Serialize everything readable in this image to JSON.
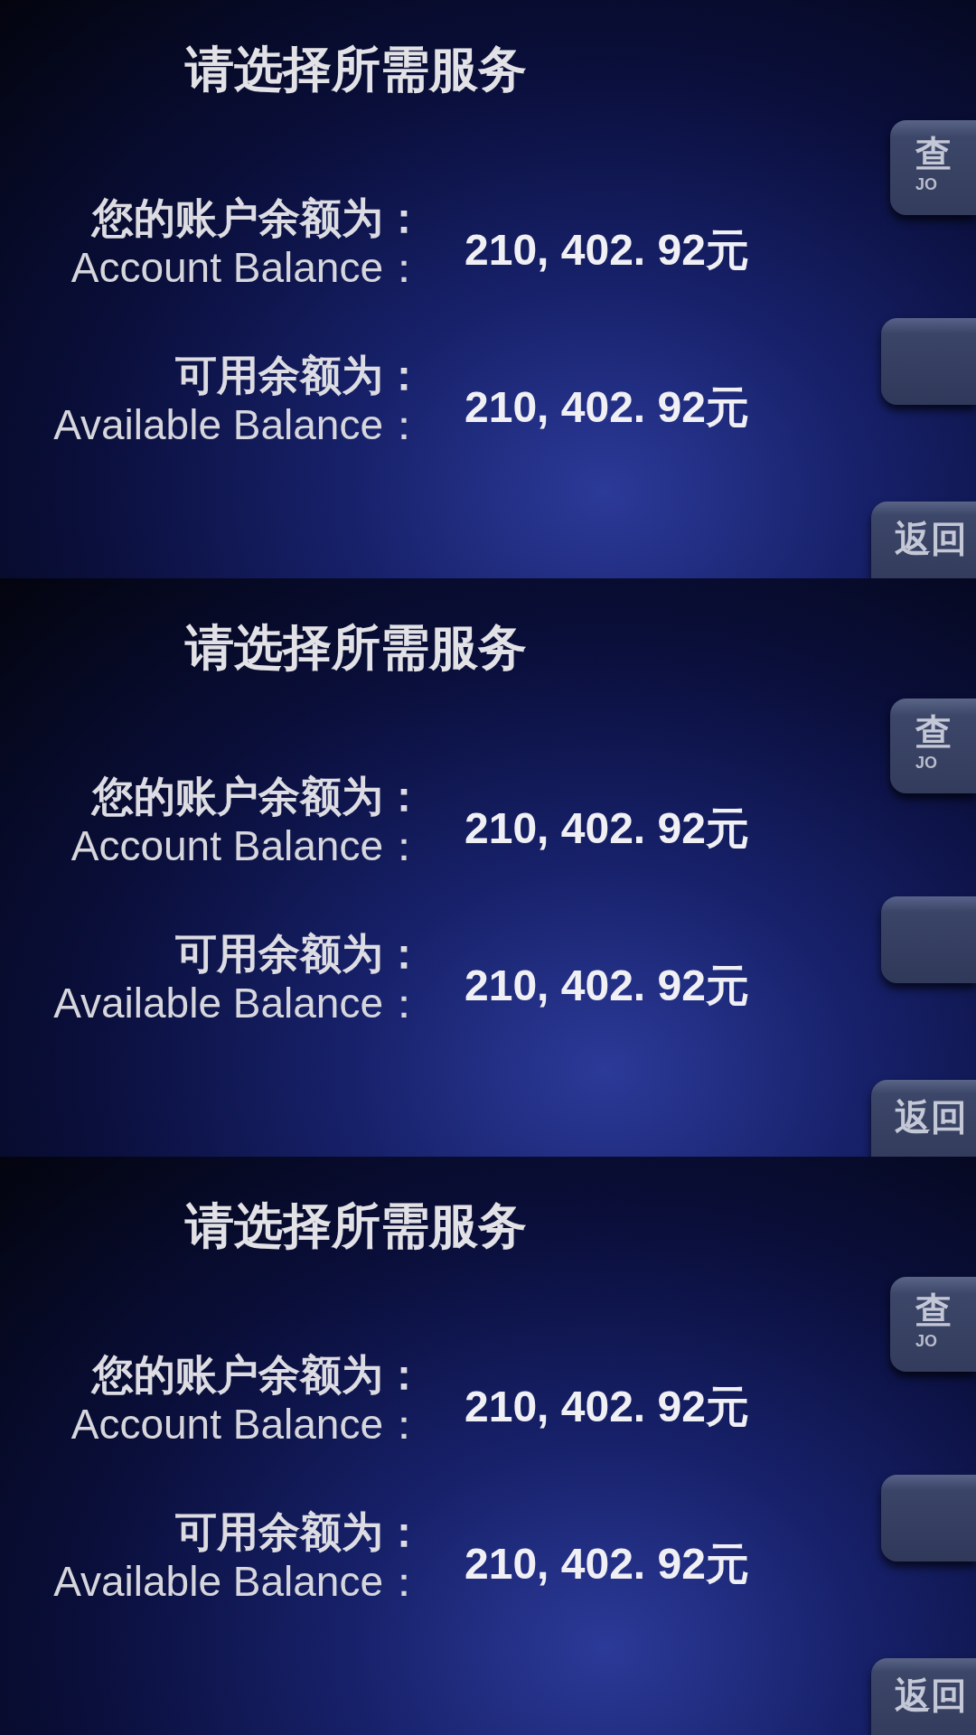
{
  "screens": [
    {
      "title": "请选择所需服务",
      "balances": [
        {
          "label": "您的账户余额为：",
          "label_en": "Account Balance：",
          "amount": "210, 402. 92元"
        },
        {
          "label": "可用余额为：",
          "label_en": "Available Balance：",
          "amount": "210, 402. 92元"
        }
      ],
      "side_buttons": [
        {
          "kind": "labeled",
          "label": "查",
          "sublabel": "JO"
        },
        {
          "kind": "blank"
        },
        {
          "kind": "labeled",
          "label": "返回"
        }
      ]
    },
    {
      "title": "请选择所需服务",
      "balances": [
        {
          "label": "您的账户余额为：",
          "label_en": "Account Balance：",
          "amount": "210, 402. 92元"
        },
        {
          "label": "可用余额为：",
          "label_en": "Available Balance：",
          "amount": "210, 402. 92元"
        }
      ],
      "side_buttons": [
        {
          "kind": "labeled",
          "label": "查",
          "sublabel": "JO"
        },
        {
          "kind": "blank"
        },
        {
          "kind": "labeled",
          "label": "返回"
        }
      ]
    },
    {
      "title": "请选择所需服务",
      "balances": [
        {
          "label": "您的账户余额为：",
          "label_en": "Account Balance：",
          "amount": "210, 402. 92元"
        },
        {
          "label": "可用余额为：",
          "label_en": "Available Balance：",
          "amount": "210, 402. 92元"
        }
      ],
      "side_buttons": [
        {
          "kind": "labeled",
          "label": "查",
          "sublabel": "JO"
        },
        {
          "kind": "blank"
        },
        {
          "kind": "labeled",
          "label": "返回"
        }
      ]
    }
  ]
}
